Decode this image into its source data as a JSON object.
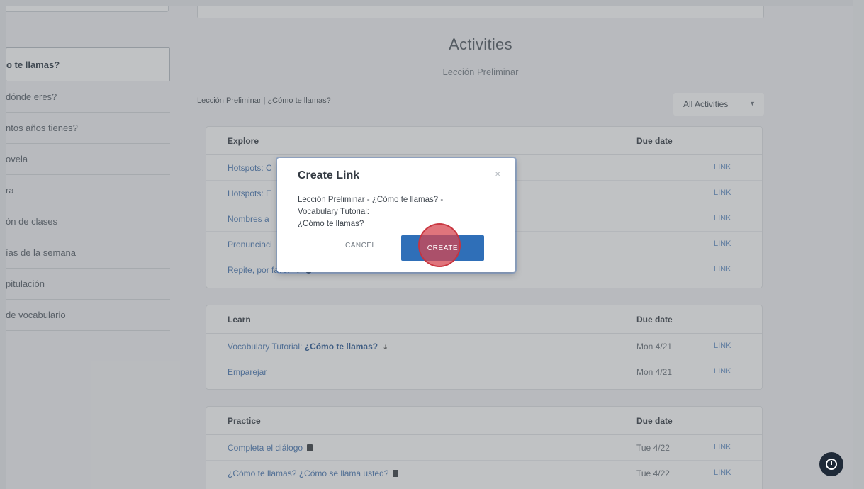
{
  "sidebar": {
    "items": [
      {
        "label": "o te llamas?",
        "active": true
      },
      {
        "label": "dónde eres?",
        "active": false
      },
      {
        "label": "ntos años tienes?",
        "active": false
      },
      {
        "label": "ovela",
        "active": false
      },
      {
        "label": "ra",
        "active": false
      },
      {
        "label": "ón de clases",
        "active": false
      },
      {
        "label": "ías de la semana",
        "active": false
      },
      {
        "label": "pitulación",
        "active": false
      },
      {
        "label": "de vocabulario",
        "active": false
      }
    ]
  },
  "main": {
    "title": "Activities",
    "subtitle": "Lección Preliminar",
    "breadcrumb": "Lección Preliminar | ¿Cómo te llamas?",
    "filter": {
      "selected": "All Activities"
    },
    "sections": [
      {
        "name": "Explore",
        "due_header": "Due date",
        "rows": [
          {
            "name": "Hotspots: C",
            "due": "",
            "link": "LINK"
          },
          {
            "name": "Hotspots: E",
            "due": "",
            "link": "LINK"
          },
          {
            "name": "Nombres a",
            "due": "",
            "link": "LINK"
          },
          {
            "name": "Pronunciaci",
            "due": "",
            "link": "LINK"
          },
          {
            "name": "Repite, por favor",
            "due": "",
            "link": "LINK"
          }
        ]
      },
      {
        "name": "Learn",
        "due_header": "Due date",
        "rows": [
          {
            "name": "Vocabulary Tutorial: ",
            "bold": "¿Cómo te llamas?",
            "due": "Mon 4/21",
            "link": "LINK"
          },
          {
            "name": "Emparejar",
            "bold": "",
            "due": "Mon 4/21",
            "link": "LINK"
          }
        ]
      },
      {
        "name": "Practice",
        "due_header": "Due date",
        "rows": [
          {
            "name": "Completa el diálogo",
            "due": "Tue 4/22",
            "link": "LINK"
          },
          {
            "name": "¿Cómo te llamas? ¿Cómo se llama usted?",
            "due": "Tue 4/22",
            "link": "LINK"
          }
        ]
      }
    ]
  },
  "modal": {
    "title": "Create Link",
    "close_icon": "close-icon",
    "text_line1": "Lección Preliminar - ¿Cómo te llamas? -",
    "text_line2": "Vocabulary Tutorial:",
    "text_line3": "¿Cómo te llamas?",
    "cancel_label": "CANCEL",
    "create_label": "CREATE"
  },
  "help": {
    "icon": "help-icon"
  }
}
